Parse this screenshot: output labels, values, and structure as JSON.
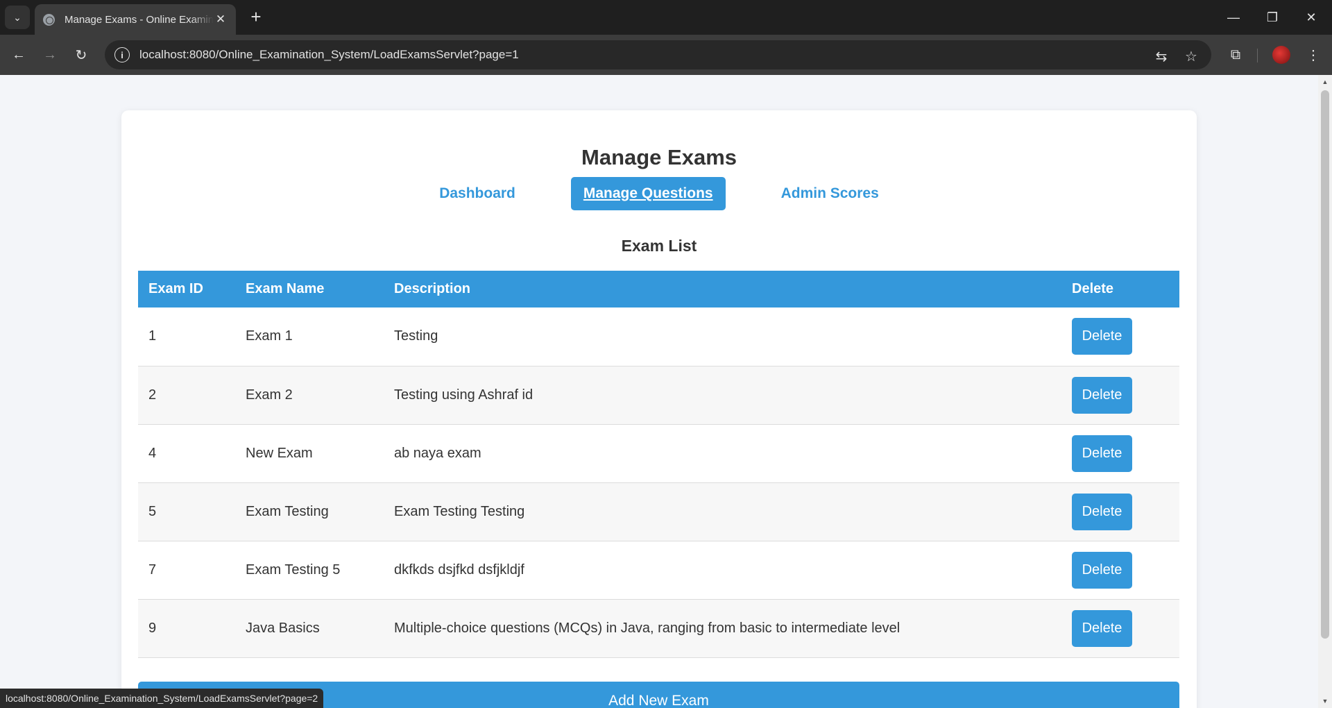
{
  "browser": {
    "tab_title": "Manage Exams - Online Examination System",
    "tab_close": "✕",
    "new_tab": "+",
    "url": "localhost:8080/Online_Examination_System/LoadExamsServlet?page=1",
    "status_url": "localhost:8080/Online_Examination_System/LoadExamsServlet?page=2"
  },
  "header": {
    "title": "Manage Exams"
  },
  "nav": [
    {
      "label": "Dashboard"
    },
    {
      "label": "Manage Questions"
    },
    {
      "label": "Admin Scores"
    }
  ],
  "section_title": "Exam List",
  "table": {
    "headers": [
      "Exam ID",
      "Exam Name",
      "Description",
      "Delete"
    ],
    "delete_label": "Delete",
    "rows": [
      {
        "id": "1",
        "name": "Exam 1",
        "description": "Testing"
      },
      {
        "id": "2",
        "name": "Exam 2",
        "description": "Testing using Ashraf id"
      },
      {
        "id": "4",
        "name": "New Exam",
        "description": "ab naya exam"
      },
      {
        "id": "5",
        "name": "Exam Testing",
        "description": "Exam Testing Testing"
      },
      {
        "id": "7",
        "name": "Exam Testing 5",
        "description": "dkfkds dsjfkd dsfjkldjf"
      },
      {
        "id": "9",
        "name": "Java Basics",
        "description": "Multiple-choice questions (MCQs) in Java, ranging from basic to intermediate level"
      }
    ]
  },
  "add_button": "Add New Exam",
  "colors": {
    "accent": "#3498db",
    "chrome_dark": "#1f1f1f",
    "page_bg": "#f3f5f9"
  }
}
